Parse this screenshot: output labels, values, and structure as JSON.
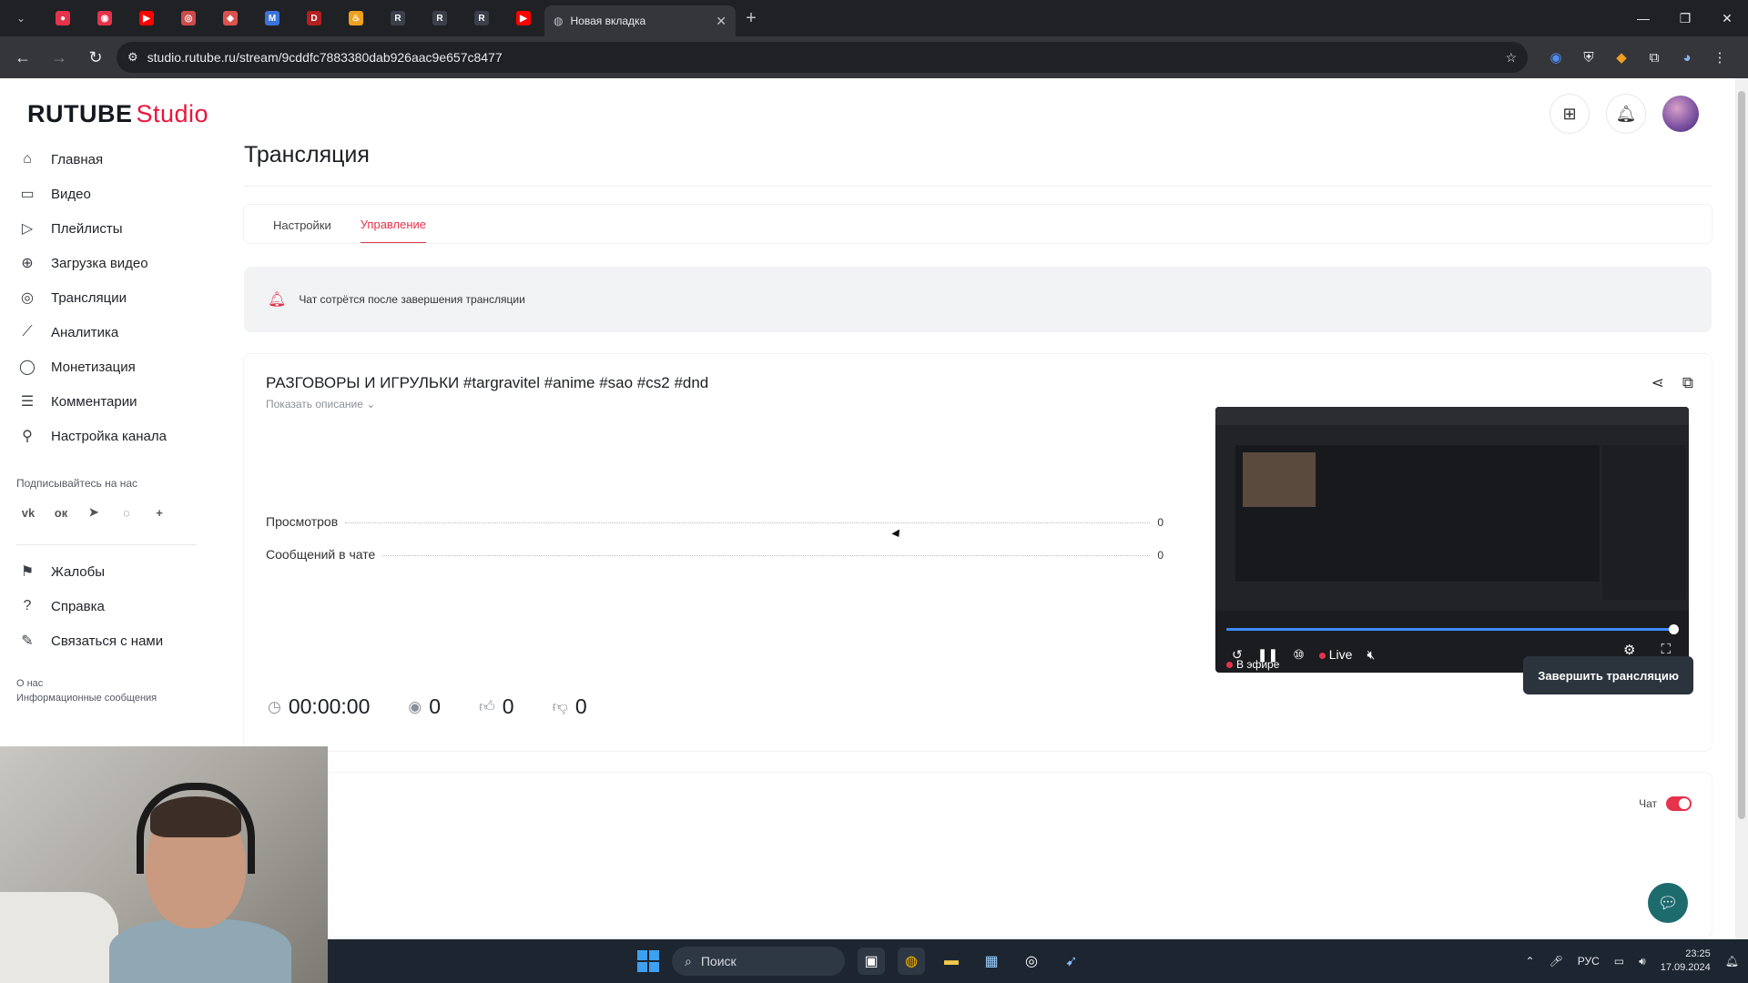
{
  "browser": {
    "tabs_mini": [
      {
        "icon": "rutube-icon",
        "color": "#e5334b",
        "glyph": "●"
      },
      {
        "icon": "radio-icon",
        "color": "#e5334b",
        "glyph": "◉"
      },
      {
        "icon": "youtube-icon",
        "color": "#ff0000",
        "glyph": "▶"
      },
      {
        "icon": "app-icon",
        "color": "#cc4b4b",
        "glyph": "◎"
      },
      {
        "icon": "shield-icon",
        "color": "#d9534f",
        "glyph": "◆"
      },
      {
        "icon": "docs-icon",
        "color": "#3b73d9",
        "glyph": "M"
      },
      {
        "icon": "dps-icon",
        "color": "#b02020",
        "glyph": "D"
      },
      {
        "icon": "fire-icon",
        "color": "#f0a020",
        "glyph": "♨"
      },
      {
        "icon": "rutube-r-icon",
        "color": "#3a3f4a",
        "glyph": "R"
      },
      {
        "icon": "rutube-r-icon",
        "color": "#3a3f4a",
        "glyph": "R"
      },
      {
        "icon": "rutube-r-icon",
        "color": "#3a3f4a",
        "glyph": "R"
      },
      {
        "icon": "youtube-icon",
        "color": "#ff0000",
        "glyph": "▶"
      }
    ],
    "active_tab_title": "Новая вкладка",
    "url": "studio.rutube.ru/stream/9cddfc7883380dab926aac9e657c8477"
  },
  "header": {
    "logo_main": "RUTUBE",
    "logo_sub": "Studio"
  },
  "sidebar": {
    "items": [
      {
        "label": "Главная",
        "icon": "home-icon",
        "glyph": "⌂"
      },
      {
        "label": "Видео",
        "icon": "video-icon",
        "glyph": "▭"
      },
      {
        "label": "Плейлисты",
        "icon": "playlist-icon",
        "glyph": "▷"
      },
      {
        "label": "Загрузка видео",
        "icon": "upload-icon",
        "glyph": "⊕"
      },
      {
        "label": "Трансляции",
        "icon": "broadcast-icon",
        "glyph": "◎"
      },
      {
        "label": "Аналитика",
        "icon": "analytics-icon",
        "glyph": "⟋"
      },
      {
        "label": "Монетизация",
        "icon": "money-icon",
        "glyph": "◯"
      },
      {
        "label": "Комментарии",
        "icon": "comments-icon",
        "glyph": "☰"
      },
      {
        "label": "Настройка канала",
        "icon": "wand-icon",
        "glyph": "⚲"
      }
    ],
    "subscribe_title": "Подписывайтесь на нас",
    "socials": [
      {
        "icon": "vk-icon",
        "glyph": "vk"
      },
      {
        "icon": "ok-icon",
        "glyph": "ок"
      },
      {
        "icon": "telegram-icon",
        "glyph": "➤"
      },
      {
        "icon": "viber-icon",
        "glyph": "◌"
      },
      {
        "icon": "plus-icon",
        "glyph": "+"
      }
    ],
    "bottom_items": [
      {
        "label": "Жалобы",
        "icon": "flag-icon",
        "glyph": "⚑"
      },
      {
        "label": "Справка",
        "icon": "help-icon",
        "glyph": "?"
      },
      {
        "label": "Связаться с нами",
        "icon": "edit-icon",
        "glyph": "✎"
      }
    ],
    "footer_about": "О нас",
    "footer_info": "Информационные сообщения"
  },
  "main": {
    "page_title": "Трансляция",
    "tabs": [
      {
        "label": "Настройки",
        "active": false
      },
      {
        "label": "Управление",
        "active": true
      }
    ],
    "notice_text": "Чат сотрётся после завершения трансляции",
    "stream": {
      "title": "РАЗГОВОРЫ И ИГРУЛЬКИ #targravitel #anime #sao #cs2 #dnd",
      "show_description": "Показать описание ⌄",
      "stats": [
        {
          "label": "Просмотров",
          "value": "0"
        },
        {
          "label": "Сообщений в чате",
          "value": "0"
        }
      ],
      "timer": "00:00:00",
      "viewers": "0",
      "likes": "0",
      "dislikes": "0",
      "end_button": "Завершить трансляцию",
      "player": {
        "onair": "В эфире",
        "live_label": "Live",
        "progress": 0.99
      }
    },
    "chat_label": "Чат",
    "chat_enabled": true
  },
  "taskbar": {
    "search_label": "Поиск",
    "lang": "РУС",
    "time": "23:25",
    "date": "17.09.2024"
  }
}
